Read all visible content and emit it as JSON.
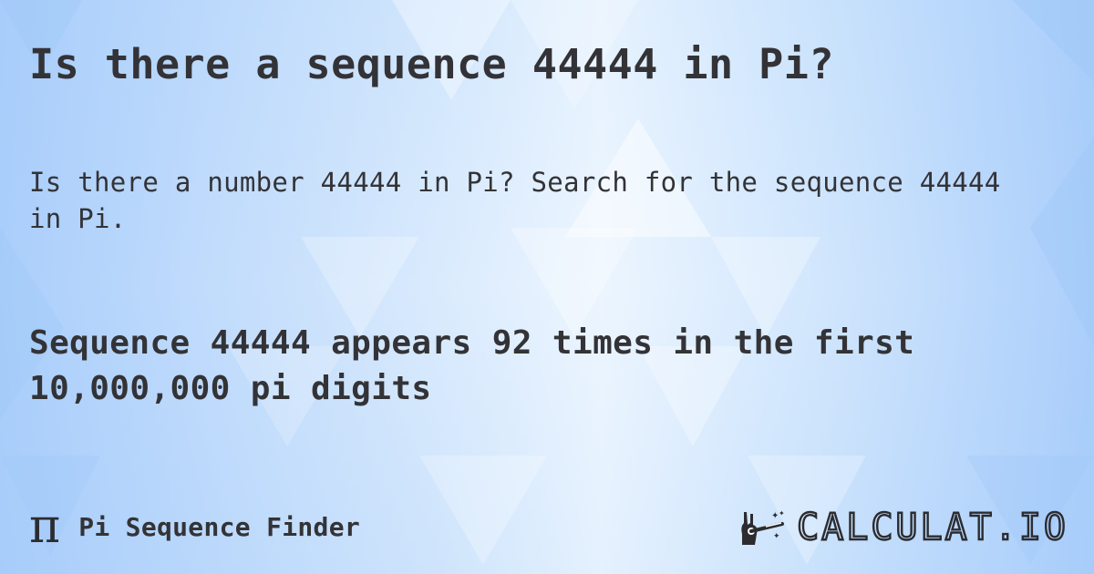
{
  "page": {
    "title": "Is there a sequence 44444 in Pi?",
    "description": "Is there a number 44444 in Pi? Search for the sequence 44444 in Pi.",
    "result": "Sequence 44444 appears 92 times in the first 10,000,000 pi digits"
  },
  "footer": {
    "tool_icon": "π",
    "tool_name": "Pi Sequence Finder",
    "logo_text": "CALCULAT.IO"
  },
  "colors": {
    "text": "#333337",
    "background": "#c9e2fc"
  }
}
